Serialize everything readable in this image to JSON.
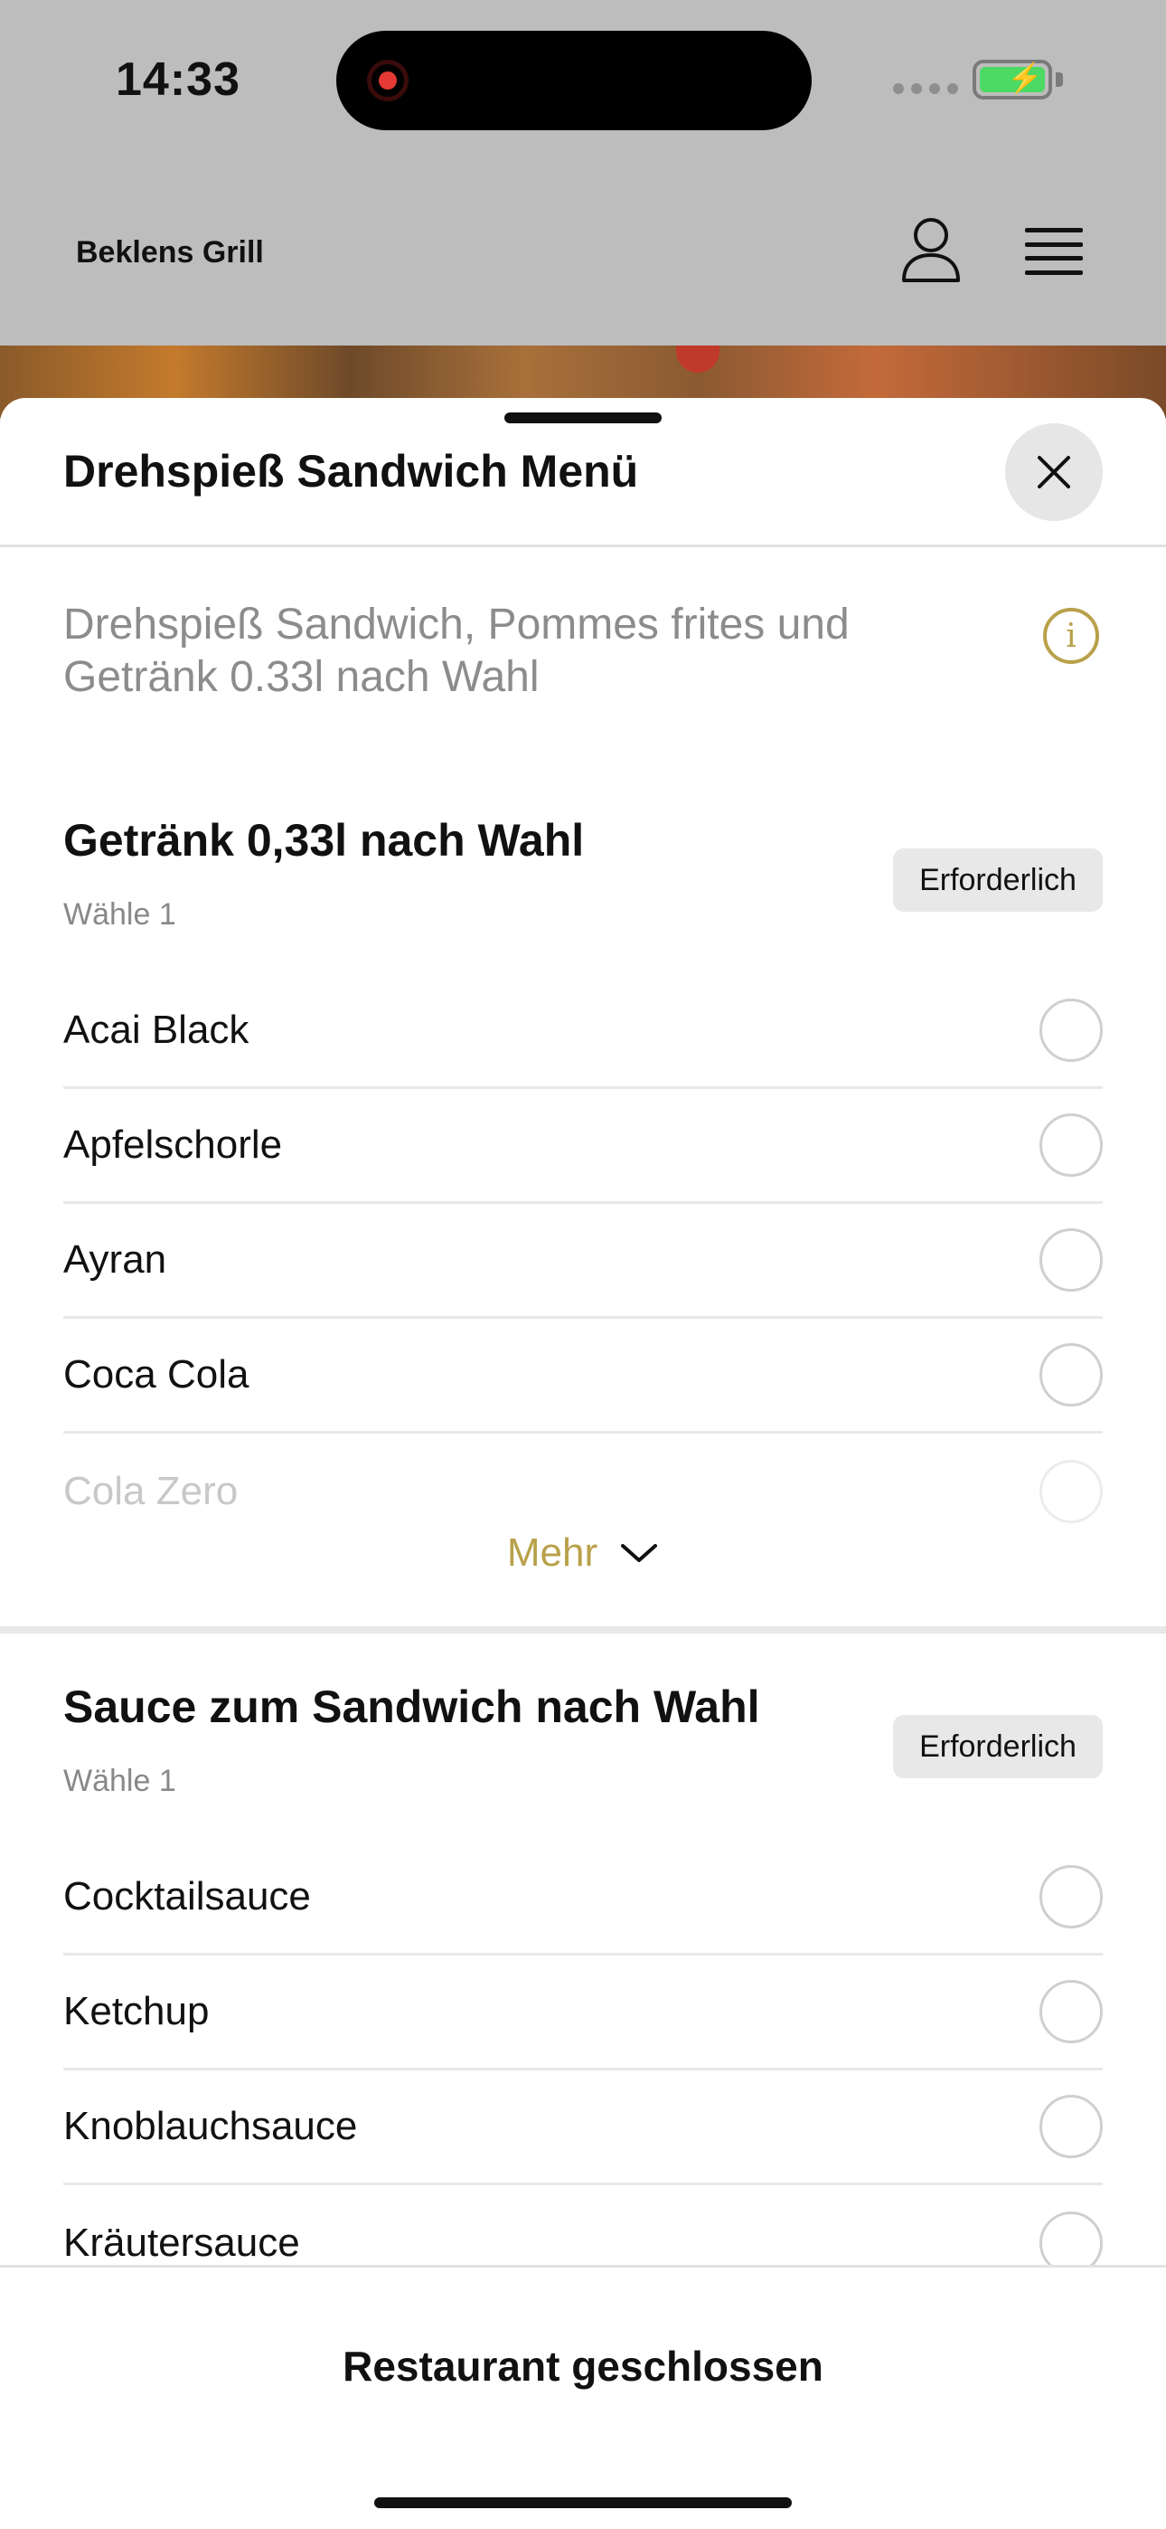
{
  "status_bar": {
    "time": "14:33",
    "icons": [
      "recording-icon",
      "signal-icon",
      "battery-charging-icon"
    ],
    "colors": {
      "recording": "#e53935",
      "battery": "#4cd964"
    }
  },
  "header": {
    "brand": "Beklens Grill",
    "icons": [
      "user-icon",
      "menu-icon"
    ]
  },
  "sheet": {
    "title": "Drehspieß Sandwich Menü",
    "description": "Drehspieß Sandwich, Pommes frites und Getränk 0.33l nach Wahl",
    "icons": [
      "close-icon",
      "info-icon"
    ],
    "accent_color": "#b8a14a"
  },
  "groups": [
    {
      "title": "Getränk 0,33l nach Wahl",
      "subtitle": "Wähle 1",
      "badge": "Erforderlich",
      "options": [
        "Acai Black",
        "Apfelschorle",
        "Ayran",
        "Coca Cola",
        "Cola Zero"
      ],
      "more_label": "Mehr"
    },
    {
      "title": "Sauce zum Sandwich nach Wahl",
      "subtitle": "Wähle 1",
      "badge": "Erforderlich",
      "options": [
        "Cocktailsauce",
        "Ketchup",
        "Knoblauchsauce",
        "Kräutersauce"
      ]
    }
  ],
  "footer": {
    "label": "Restaurant geschlossen"
  }
}
